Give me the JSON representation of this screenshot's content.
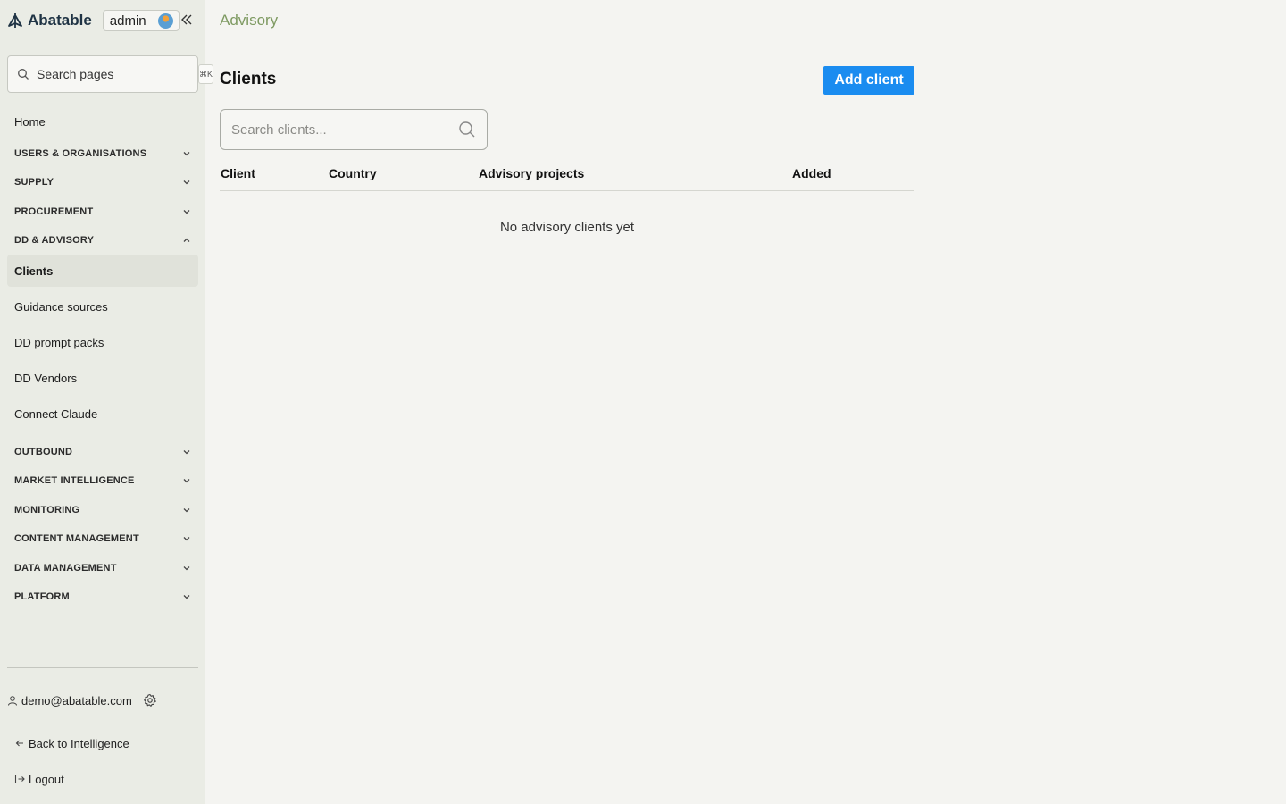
{
  "brand": {
    "name": "Abatable",
    "role_badge": "admin"
  },
  "sidebar": {
    "search_placeholder": "Search pages",
    "search_shortcut": "⌘K",
    "home": "Home",
    "sections_top": [
      {
        "label": "USERS & ORGANISATIONS",
        "expanded": false
      },
      {
        "label": "SUPPLY",
        "expanded": false
      },
      {
        "label": "PROCUREMENT",
        "expanded": false
      },
      {
        "label": "DD & ADVISORY",
        "expanded": true
      }
    ],
    "dd_items": [
      {
        "label": "Clients",
        "active": true
      },
      {
        "label": "Guidance sources",
        "active": false
      },
      {
        "label": "DD prompt packs",
        "active": false
      },
      {
        "label": "DD Vendors",
        "active": false
      },
      {
        "label": "Connect Claude",
        "active": false
      }
    ],
    "sections_bottom": [
      {
        "label": "OUTBOUND",
        "expanded": false
      },
      {
        "label": "MARKET INTELLIGENCE",
        "expanded": false
      },
      {
        "label": "MONITORING",
        "expanded": false
      },
      {
        "label": "CONTENT MANAGEMENT",
        "expanded": false
      },
      {
        "label": "DATA MANAGEMENT",
        "expanded": false
      },
      {
        "label": "PLATFORM",
        "expanded": false
      }
    ],
    "user_email": "demo@abatable.com",
    "back_link": "Back to Intelligence",
    "logout": "Logout"
  },
  "main": {
    "breadcrumb": "Advisory",
    "title": "Clients",
    "add_button": "Add client",
    "search_placeholder": "Search clients...",
    "columns": [
      "Client",
      "Country",
      "Advisory projects",
      "Added"
    ],
    "empty_message": "No advisory clients yet"
  },
  "colors": {
    "accent_button": "#1a8cf0",
    "breadcrumb": "#7e9a62",
    "sidebar_bg": "#eaece5",
    "page_bg": "#f4f4f1"
  }
}
